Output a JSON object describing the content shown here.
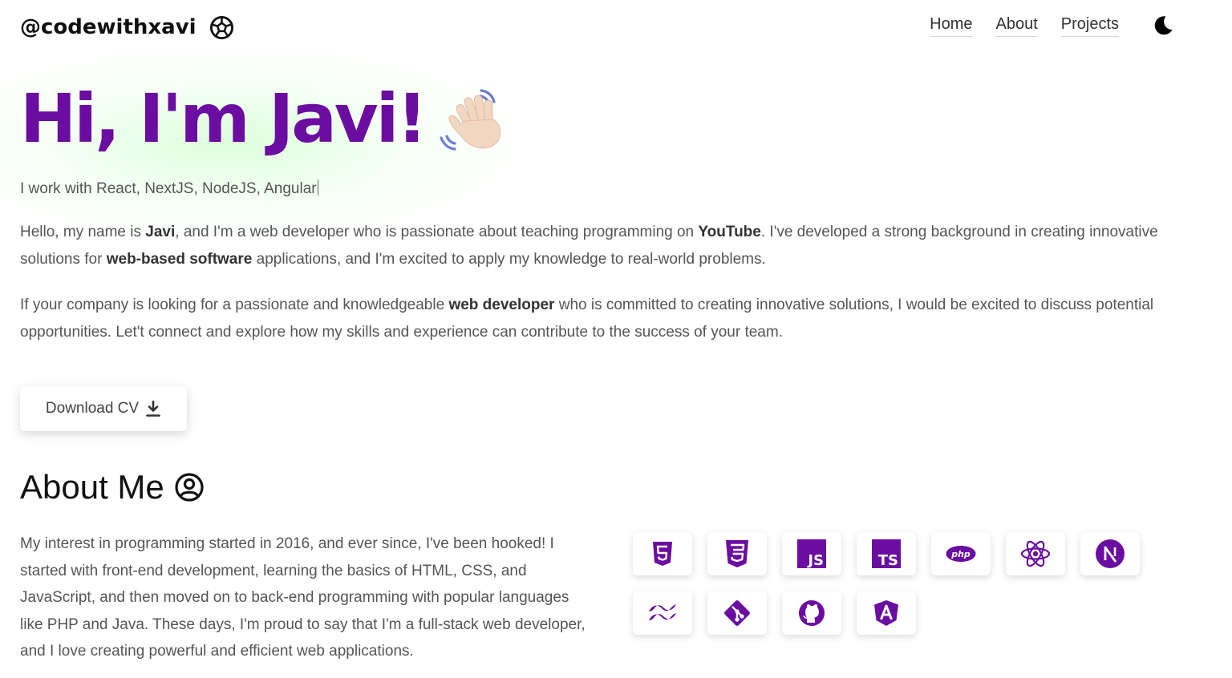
{
  "header": {
    "brand": "@codewithxavi",
    "nav": [
      "Home",
      "About",
      "Projects"
    ]
  },
  "hero": {
    "title": "Hi, I'm Javi!",
    "typed": "I work with React, NextJS, NodeJS, Angular"
  },
  "intro": {
    "p1": {
      "a": "Hello, my name is ",
      "b1": "Javi",
      "c": ", and I'm a web developer who is passionate about teaching programming on ",
      "b2": "YouTube",
      "d": ". I've developed a strong background in creating innovative solutions for ",
      "b3": "web-based software",
      "e": " applications, and I'm excited to apply my knowledge to real-world problems."
    },
    "p2": {
      "a": "If your company is looking for a passionate and knowledgeable ",
      "b1": "web developer",
      "c": " who is committed to creating innovative solutions, I would be excited to discuss potential opportunities. Let't connect and explore how my skills and experience can contribute to the success of your team."
    }
  },
  "cv_button": {
    "label": "Download CV"
  },
  "about": {
    "title": "About Me",
    "text": "My interest in programming started in 2016, and ever since, I've been hooked! I started with front-end development, learning the basics of HTML, CSS, and JavaScript, and then moved on to back-end programming with popular languages like PHP and Java. These days, I'm proud to say that I'm a full-stack web developer, and I love creating powerful and efficient web applications."
  },
  "skill_icons": [
    "html5-icon",
    "css3-icon",
    "javascript-icon",
    "typescript-icon",
    "php-icon",
    "react-icon",
    "nextjs-icon",
    "tailwind-icon",
    "git-icon",
    "github-icon",
    "angular-icon"
  ],
  "colors": {
    "accent": "#6a0da0",
    "text": "#555555",
    "glow": "#d9ffd9"
  }
}
